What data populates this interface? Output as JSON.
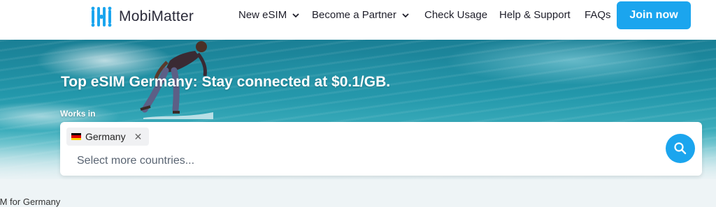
{
  "brand": {
    "name": "MobiMatter",
    "logo_icon": "mobimatter-logo-icon"
  },
  "nav": {
    "items": [
      {
        "label": "New eSIM",
        "has_dropdown": true
      },
      {
        "label": "Become a Partner",
        "has_dropdown": true
      },
      {
        "label": "Check Usage",
        "has_dropdown": false
      },
      {
        "label": "Help & Support",
        "has_dropdown": false
      },
      {
        "label": "FAQs",
        "has_dropdown": false
      }
    ],
    "cta": "Join now"
  },
  "hero": {
    "title": "Top eSIM Germany: Stay connected at $0.1/GB.",
    "works_in_label": "Works in",
    "selected_countries": [
      {
        "name": "Germany",
        "flag_icon": "germany-flag-icon"
      }
    ],
    "search_placeholder": "Select more countries...",
    "search_icon": "search-icon"
  },
  "below_fold": {
    "section_title_partial": "IM for Germany"
  },
  "colors": {
    "accent": "#1ba5ee",
    "text_dark": "#1e1e2a",
    "header_bg": "#ffffff"
  }
}
